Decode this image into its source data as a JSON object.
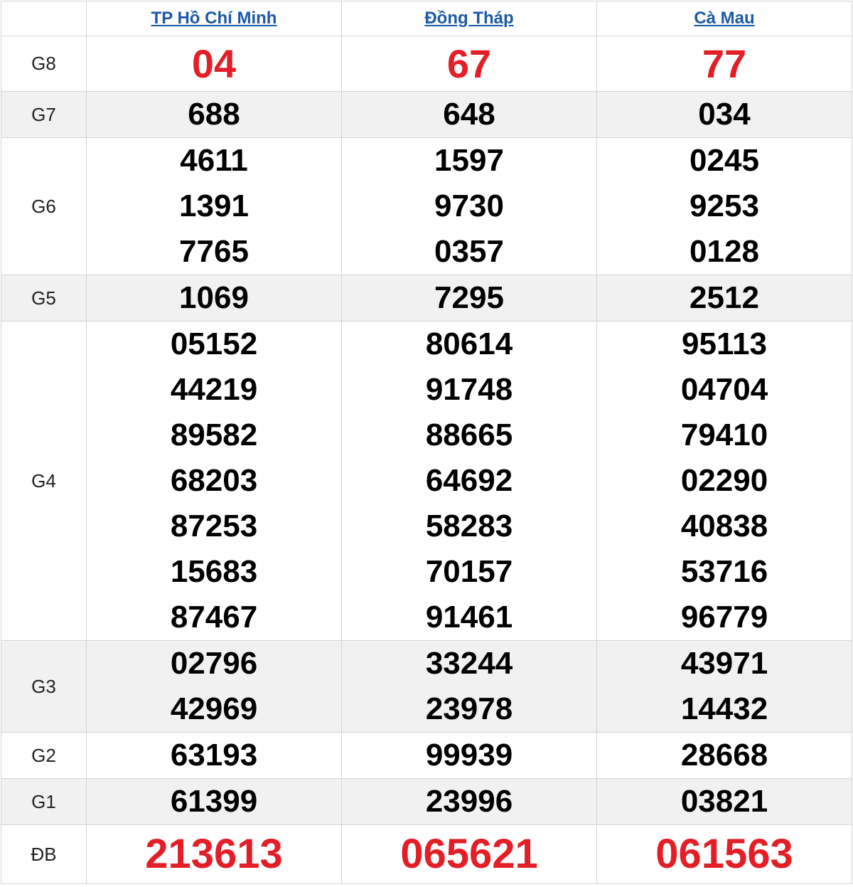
{
  "provinces": [
    "TP Hồ Chí Minh",
    "Đồng Tháp",
    "Cà Mau"
  ],
  "prizes": [
    {
      "label": "G8",
      "values": [
        [
          "04"
        ],
        [
          "67"
        ],
        [
          "77"
        ]
      ]
    },
    {
      "label": "G7",
      "values": [
        [
          "688"
        ],
        [
          "648"
        ],
        [
          "034"
        ]
      ]
    },
    {
      "label": "G6",
      "values": [
        [
          "4611",
          "1391",
          "7765"
        ],
        [
          "1597",
          "9730",
          "0357"
        ],
        [
          "0245",
          "9253",
          "0128"
        ]
      ]
    },
    {
      "label": "G5",
      "values": [
        [
          "1069"
        ],
        [
          "7295"
        ],
        [
          "2512"
        ]
      ]
    },
    {
      "label": "G4",
      "values": [
        [
          "05152",
          "44219",
          "89582",
          "68203",
          "87253",
          "15683",
          "87467"
        ],
        [
          "80614",
          "91748",
          "88665",
          "64692",
          "58283",
          "70157",
          "91461"
        ],
        [
          "95113",
          "04704",
          "79410",
          "02290",
          "40838",
          "53716",
          "96779"
        ]
      ]
    },
    {
      "label": "G3",
      "values": [
        [
          "02796",
          "42969"
        ],
        [
          "33244",
          "23978"
        ],
        [
          "43971",
          "14432"
        ]
      ]
    },
    {
      "label": "G2",
      "values": [
        [
          "63193"
        ],
        [
          "99939"
        ],
        [
          "28668"
        ]
      ]
    },
    {
      "label": "G1",
      "values": [
        [
          "61399"
        ],
        [
          "23996"
        ],
        [
          "03821"
        ]
      ]
    },
    {
      "label": "ĐB",
      "values": [
        [
          "213613"
        ],
        [
          "065621"
        ],
        [
          "061563"
        ]
      ]
    }
  ],
  "colors": {
    "highlight_red": "#e41e26",
    "link_blue": "#1c5aa6",
    "alt_row_bg": "#f1f1f1"
  }
}
